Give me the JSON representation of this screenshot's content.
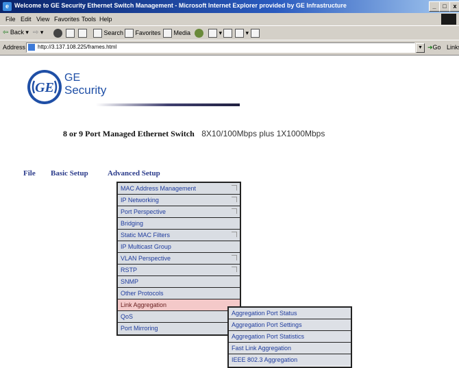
{
  "window": {
    "title": "Welcome to GE Security Ethernet Switch Management - Microsoft Internet Explorer provided by GE Infrastructure",
    "minimize": "_",
    "maximize": "□",
    "close": "x"
  },
  "menubar": [
    "File",
    "Edit",
    "View",
    "Favorites",
    "Tools",
    "Help"
  ],
  "toolbar": {
    "back": "Back",
    "search": "Search",
    "favorites": "Favorites",
    "media": "Media"
  },
  "address": {
    "label": "Address",
    "value": "http://3.137.108.225/frames.html",
    "go": "Go",
    "links": "Links"
  },
  "logo": {
    "seal_text": "GE",
    "line1": "GE",
    "line2": "Security"
  },
  "heading": {
    "product": "8 or 9 Port Managed Ethernet Switch",
    "spec": "8X10/100Mbps plus 1X1000Mbps"
  },
  "nav": {
    "file": "File",
    "basic": "Basic Setup",
    "advanced": "Advanced Setup"
  },
  "advanced_menu": {
    "items": [
      {
        "label": "MAC Address Management",
        "submenu": true
      },
      {
        "label": "IP Networking",
        "submenu": true
      },
      {
        "label": "Port Perspective",
        "submenu": true
      },
      {
        "label": "Bridging",
        "submenu": false
      },
      {
        "label": "Static MAC Filters",
        "submenu": true
      },
      {
        "label": "IP Multicast Group",
        "submenu": false
      },
      {
        "label": "VLAN Perspective",
        "submenu": true
      },
      {
        "label": "RSTP",
        "submenu": true
      },
      {
        "label": "SNMP",
        "submenu": false
      },
      {
        "label": "Other Protocols",
        "submenu": false
      },
      {
        "label": "Link Aggregation",
        "submenu": false,
        "highlighted": true
      },
      {
        "label": "QoS",
        "submenu": false
      },
      {
        "label": "Port Mirroring",
        "submenu": false
      }
    ]
  },
  "link_aggregation_menu": {
    "items": [
      "Aggregation Port Status",
      "Aggregation Port Settings",
      "Aggregation Port Statistics",
      "Fast Link Aggregation",
      "IEEE 802.3 Aggregation"
    ]
  },
  "colors": {
    "titlebar": "#0a246a",
    "menu_bg": "#d9dde3",
    "menu_text": "#1f3c9e",
    "highlight": "#f4c9c9",
    "brand": "#1f4fa6"
  }
}
